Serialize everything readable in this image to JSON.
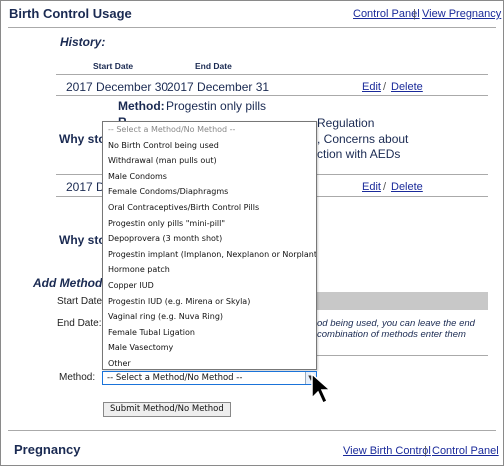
{
  "header": {
    "title": "Birth Control Usage",
    "links": [
      "Control Panel",
      "View Pregnancy"
    ],
    "separator": "|"
  },
  "history": {
    "label": "History:",
    "col_start": "Start Date",
    "col_end": "End Date",
    "entries": [
      {
        "start": "2017 December 30",
        "end": "2017 December 31",
        "edit": "Edit",
        "slash": "/",
        "delete": "Delete",
        "method_label": "Method:",
        "method_value": "Progestin only pills",
        "reason_partial": "R",
        "reason_text": "Regulation",
        "why_label": "Why stop",
        "why_text_line1": ", Concerns about",
        "why_text_line2": "ction with AEDs"
      },
      {
        "start_partial": "2017 De",
        "edit": "Edit",
        "slash": "/",
        "delete": "Delete",
        "why_label": "Why stop"
      }
    ]
  },
  "add": {
    "label": "Add Method/N",
    "start_label": "Start Date",
    "end_label": "End Date:",
    "note_line1": "od being used, you can leave the end",
    "note_line2": "combination of methods enter them",
    "method_label": "Method:",
    "select_value": "-- Select a Method/No Method --",
    "submit_label": "Submit Method/No Method"
  },
  "dropdown": {
    "options": [
      "-- Select a Method/No Method --",
      "No Birth Control being used",
      "Withdrawal (man pulls out)",
      "Male Condoms",
      "Female Condoms/Diaphragms",
      "Oral Contraceptives/Birth Control Pills",
      "Progestin only pills \"mini-pill\"",
      "Depoprovera (3 month shot)",
      "Progestin implant (Implanon, Nexplanon or Norplant)",
      "Hormone patch",
      "Copper IUD",
      "Progestin IUD (e.g. Mirena or Skyla)",
      "Vaginal ring (e.g. Nuva Ring)",
      "Female Tubal Ligation",
      "Male Vasectomy",
      "Other"
    ]
  },
  "pregnancy": {
    "title": "Pregnancy",
    "links": [
      "View Birth Control",
      "Control Panel"
    ],
    "separator": "|"
  },
  "colors": {
    "navy": "#1a2a52",
    "link": "#1a2a9a",
    "select_border": "#1a73d9"
  }
}
